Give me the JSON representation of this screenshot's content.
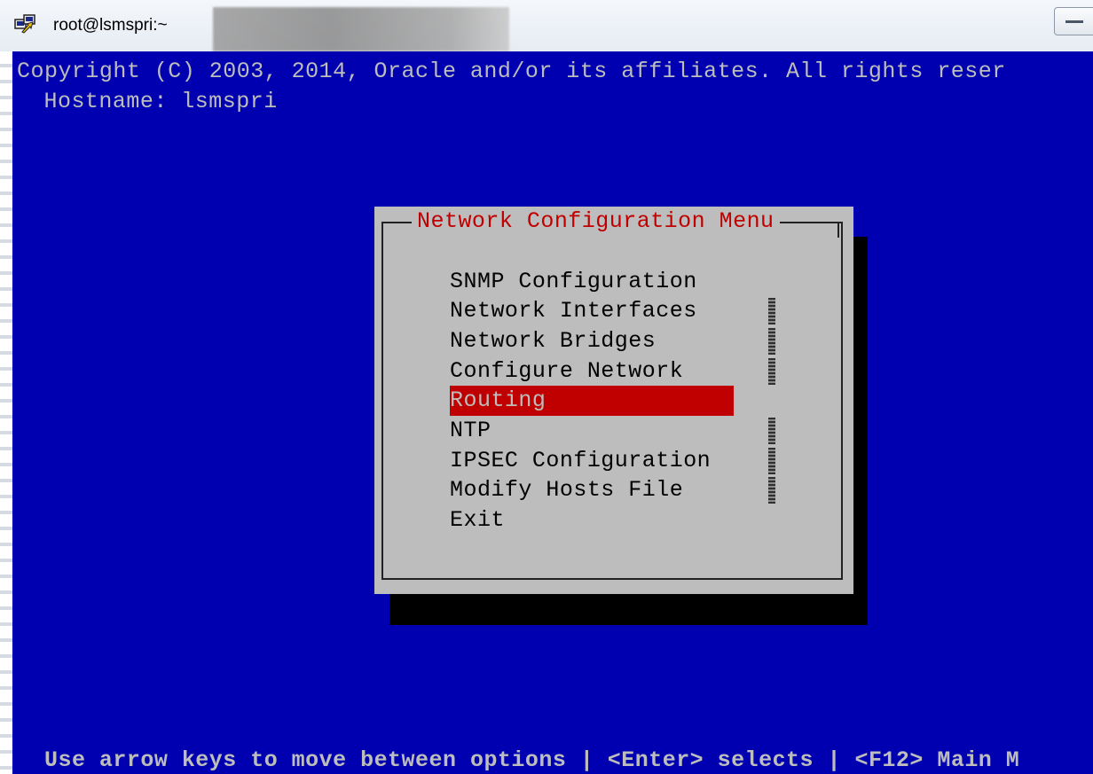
{
  "window": {
    "title": "root@lsmspri:~"
  },
  "terminal": {
    "copyright": "Copyright (C) 2003, 2014, Oracle and/or its affiliates. All rights reser",
    "hostname": " Hostname: lsmspri",
    "status_line": "Use arrow keys to move between options | <Enter> selects | <F12> Main M"
  },
  "dialog": {
    "title": "Network Configuration Menu",
    "items": [
      {
        "label": "SNMP Configuration"
      },
      {
        "label": "Network Interfaces"
      },
      {
        "label": "Network Bridges"
      },
      {
        "label": "Configure Network"
      },
      {
        "label": "Routing"
      },
      {
        "label": "NTP"
      },
      {
        "label": "IPSEC Configuration"
      },
      {
        "label": "Modify Hosts File"
      },
      {
        "label": "Exit"
      }
    ],
    "selected_index": 4
  },
  "colors": {
    "terminal_bg": "#0000b0",
    "dialog_bg": "#bdbdbd",
    "accent_red": "#c00000",
    "text_gray": "#bdbdbd"
  }
}
